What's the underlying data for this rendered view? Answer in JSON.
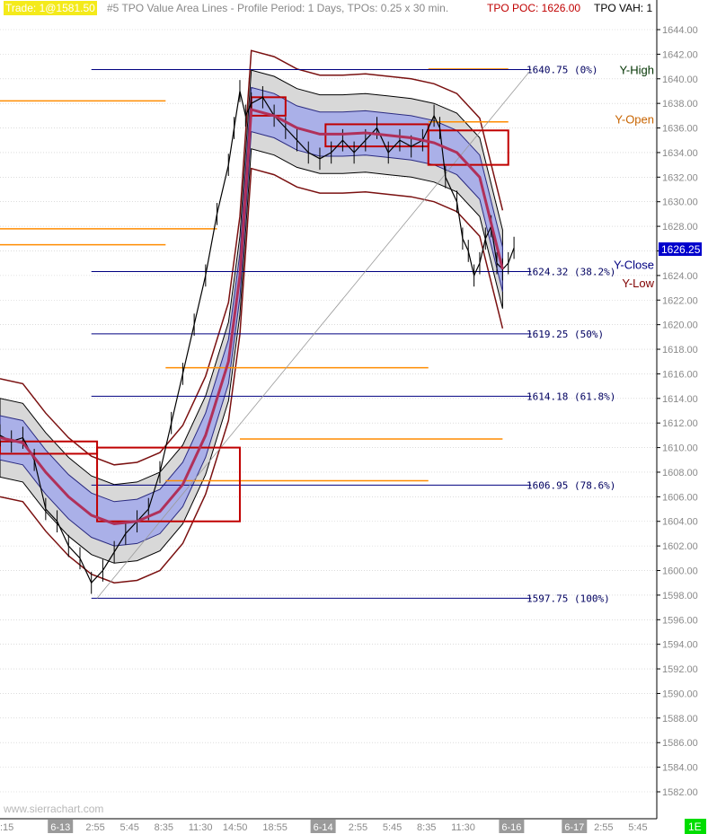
{
  "header": {
    "trade": "Trade: 1@1581.50",
    "study": "#5  TPO Value Area Lines - Profile Period: 1 Days, TPOs: 0.25 x 30 min.",
    "poc": "TPO POC: 1626.00",
    "vah": "TPO VAH: 1"
  },
  "watermark": "www.sierrachart.com",
  "current_price": "1626.25",
  "corner_badge": "1E",
  "colors": {
    "trade_bg": "#f4ea1b",
    "poc": "#c00000",
    "orange": "#ff8c00",
    "envelope": "#7a1010",
    "band_fill": "#aab0e8",
    "gray_band": "#d8d8d8",
    "fib_line": "#000080",
    "price_box": "#0000cc"
  },
  "ref_labels": [
    {
      "text": "Y-High",
      "price": 1640.75,
      "color": "#003300"
    },
    {
      "text": "Y-Open",
      "price": 1636.75,
      "color": "#c86400"
    },
    {
      "text": "Y-Close",
      "price": 1624.9,
      "color": "#000080"
    },
    {
      "text": "Y-Low",
      "price": 1623.4,
      "color": "#800000"
    }
  ],
  "chart_data": {
    "type": "line",
    "title": "",
    "xlabel": "",
    "ylabel": "",
    "ylim": [
      1580,
      1646
    ],
    "y_ticks": [
      1582,
      1584,
      1586,
      1588,
      1590,
      1592,
      1594,
      1596,
      1598,
      1600,
      1602,
      1604,
      1606,
      1608,
      1610,
      1612,
      1614,
      1616,
      1618,
      1620,
      1622,
      1624,
      1626,
      1628,
      1630,
      1632,
      1634,
      1636,
      1638,
      1640,
      1642,
      1644
    ],
    "x_tick_labels": [
      {
        "label": ":15",
        "x": 0,
        "highlight": false
      },
      {
        "label": "6-13",
        "x": 9,
        "highlight": true
      },
      {
        "label": "2:55",
        "x": 15,
        "highlight": false
      },
      {
        "label": "5:45",
        "x": 21,
        "highlight": false
      },
      {
        "label": "8:35",
        "x": 27,
        "highlight": false
      },
      {
        "label": "11:30",
        "x": 33,
        "highlight": false
      },
      {
        "label": "14:50",
        "x": 39,
        "highlight": false
      },
      {
        "label": "18:55",
        "x": 46,
        "highlight": false
      },
      {
        "label": "6-14",
        "x": 55,
        "highlight": true
      },
      {
        "label": "2:55",
        "x": 61,
        "highlight": false
      },
      {
        "label": "5:45",
        "x": 67,
        "highlight": false
      },
      {
        "label": "8:35",
        "x": 73,
        "highlight": false
      },
      {
        "label": "11:30",
        "x": 79,
        "highlight": false
      },
      {
        "label": "6-16",
        "x": 88,
        "highlight": true
      },
      {
        "label": "6-17",
        "x": 99,
        "highlight": true
      },
      {
        "label": "2:55",
        "x": 104,
        "highlight": false
      },
      {
        "label": "5:45",
        "x": 110,
        "highlight": false
      }
    ],
    "xlim": [
      0,
      115
    ],
    "fib_levels": [
      {
        "price": 1640.75,
        "label": "1640.75  (0%)"
      },
      {
        "price": 1624.32,
        "label": "1624.32  (38.2%)"
      },
      {
        "price": 1619.25,
        "label": "1619.25  (50%)"
      },
      {
        "price": 1614.18,
        "label": "1614.18  (61.8%)"
      },
      {
        "price": 1606.95,
        "label": "1606.95  (78.6%)"
      },
      {
        "price": 1597.75,
        "label": "1597.75  (100%)"
      }
    ],
    "orange_lines": [
      {
        "x0": 0,
        "x1": 29,
        "price": 1638.2
      },
      {
        "x0": 0,
        "x1": 38,
        "price": 1627.8
      },
      {
        "x0": 0,
        "x1": 29,
        "price": 1626.5
      },
      {
        "x0": 29,
        "x1": 75,
        "price": 1616.5
      },
      {
        "x0": 42,
        "x1": 88,
        "price": 1610.7
      },
      {
        "x0": 29,
        "x1": 75,
        "price": 1607.3
      },
      {
        "x0": 75,
        "x1": 89,
        "price": 1640.8
      },
      {
        "x0": 75,
        "x1": 89,
        "price": 1636.5
      },
      {
        "x0": 75,
        "x1": 89,
        "price": 1633.0
      }
    ],
    "poc_boxes": [
      {
        "x0": 0,
        "x1": 17,
        "price_top": 1610.5,
        "price_bot": 1609.5
      },
      {
        "x0": 17,
        "x1": 42,
        "price_top": 1610.0,
        "price_bot": 1604.0
      },
      {
        "x0": 44,
        "x1": 50,
        "price_top": 1638.5,
        "price_bot": 1637.0
      },
      {
        "x0": 57,
        "x1": 75,
        "price_top": 1636.3,
        "price_bot": 1634.5
      },
      {
        "x0": 75,
        "x1": 89,
        "price_top": 1635.8,
        "price_bot": 1633.0
      }
    ],
    "series": [
      {
        "name": "",
        "x": [
          0,
          2,
          4,
          6,
          8,
          10,
          12,
          14,
          16,
          18,
          20,
          22,
          24,
          26,
          28,
          30,
          32,
          34,
          36,
          38,
          40,
          41,
          42,
          43,
          44,
          46,
          48,
          50,
          52,
          54,
          56,
          58,
          60,
          62,
          64,
          66,
          68,
          70,
          72,
          74,
          76,
          77,
          78,
          80,
          81,
          82,
          83,
          84,
          85,
          86,
          87,
          88,
          89,
          90
        ],
        "values": [
          1611,
          1610.5,
          1610.8,
          1609,
          1605,
          1604,
          1602,
          1601,
          1599,
          1600,
          1601.5,
          1603,
          1604,
          1605,
          1608,
          1612,
          1616,
          1620,
          1624,
          1629,
          1633,
          1636,
          1639,
          1637,
          1638,
          1638.5,
          1637,
          1636,
          1635,
          1634,
          1633.5,
          1634,
          1635,
          1634,
          1635,
          1636,
          1634,
          1635,
          1634.5,
          1635,
          1637,
          1636,
          1632,
          1630,
          1627,
          1626,
          1624,
          1625,
          1627,
          1628,
          1625,
          1624.5,
          1625,
          1626.25
        ]
      },
      {
        "name": "",
        "x": [
          0,
          4,
          8,
          12,
          16,
          20,
          24,
          28,
          32,
          36,
          40,
          42,
          44,
          48,
          52,
          56,
          60,
          64,
          68,
          72,
          76,
          80,
          84,
          88
        ],
        "values": [
          1610.8,
          1610.4,
          1608,
          1606,
          1604.5,
          1603.8,
          1604,
          1604.8,
          1607,
          1611,
          1617,
          1624,
          1637.5,
          1637,
          1636,
          1635.5,
          1635.5,
          1635.6,
          1635.4,
          1635.2,
          1634.8,
          1634,
          1632,
          1624.5
        ]
      }
    ]
  }
}
